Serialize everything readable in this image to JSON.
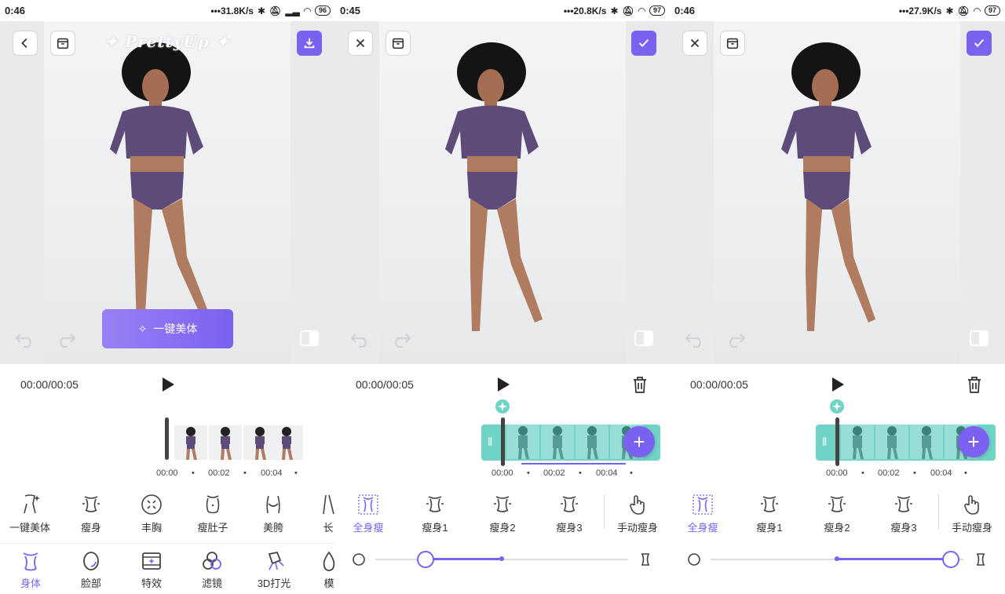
{
  "panels": [
    {
      "status": {
        "time": "0:46",
        "speed": "31.8K/s",
        "battery": "96"
      },
      "watermark": "PrettyUp",
      "onekey_label": "一键美体",
      "timecode": "00:00/00:05",
      "ticks": [
        "00:00",
        "00:02",
        "00:04"
      ],
      "tools": [
        "一键美体",
        "瘦身",
        "丰胸",
        "瘦肚子",
        "美胯",
        "长"
      ],
      "nav": [
        "身体",
        "脸部",
        "特效",
        "滤镜",
        "3D打光",
        "模"
      ]
    },
    {
      "status": {
        "time": "0:45",
        "speed": "20.8K/s",
        "battery": "97"
      },
      "timecode": "00:00/00:05",
      "ticks": [
        "00:00",
        "00:02",
        "00:04"
      ],
      "tools": [
        "全身瘦",
        "瘦身1",
        "瘦身2",
        "瘦身3",
        "手动瘦身"
      ],
      "slider_value": 0.2
    },
    {
      "status": {
        "time": "0:46",
        "speed": "27.9K/s",
        "battery": "97"
      },
      "timecode": "00:00/00:05",
      "ticks": [
        "00:00",
        "00:02",
        "00:04"
      ],
      "tools": [
        "全身瘦",
        "瘦身1",
        "瘦身2",
        "瘦身3",
        "手动瘦身"
      ],
      "slider_value": 0.95
    }
  ],
  "colors": {
    "accent": "#7b61f0",
    "teal": "#6fd3c6"
  },
  "icons": {
    "back": "chevron-left-icon",
    "close": "close-icon",
    "gallery": "archive-icon",
    "download": "download-icon",
    "confirm": "check-icon",
    "play": "play-icon",
    "delete": "trash-icon"
  }
}
